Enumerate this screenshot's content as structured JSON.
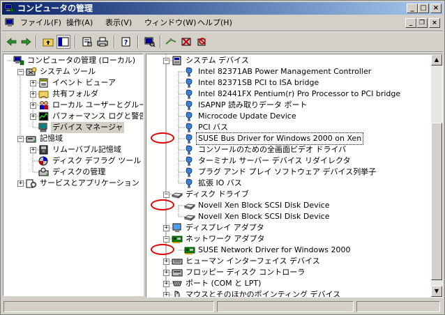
{
  "window": {
    "title": "コンピュータの管理"
  },
  "caption_buttons": {
    "minimize": "_",
    "maximize": "□",
    "close": "×"
  },
  "mdi_buttons": {
    "minimize": "_",
    "restore": "❐",
    "close": "×"
  },
  "menu": [
    {
      "label": "ファイル(F)"
    },
    {
      "label": "操作(A)"
    },
    {
      "label": "表示(V)"
    },
    {
      "label": "ウィンドウ(W)"
    },
    {
      "label": "ヘルプ(H)"
    }
  ],
  "left_tree": [
    {
      "label": "コンピュータの管理 (ローカル)",
      "icon": "computer-management-icon",
      "level": 0,
      "expander": ""
    },
    {
      "label": "システム ツール",
      "icon": "system-tools-icon",
      "level": 1,
      "expander": "-"
    },
    {
      "label": "イベント ビューア",
      "icon": "event-viewer-icon",
      "level": 2,
      "expander": "+"
    },
    {
      "label": "共有フォルダ",
      "icon": "shared-folders-icon",
      "level": 2,
      "expander": "+"
    },
    {
      "label": "ローカル ユーザーとグループ",
      "icon": "users-icon",
      "level": 2,
      "expander": "+"
    },
    {
      "label": "パフォーマンス ログと警告",
      "icon": "performance-icon",
      "level": 2,
      "expander": "+"
    },
    {
      "label": "デバイス マネージャ",
      "icon": "device-manager-icon",
      "level": 2,
      "expander": "",
      "selected": true
    },
    {
      "label": "記憶域",
      "icon": "storage-icon",
      "level": 1,
      "expander": "-"
    },
    {
      "label": "リムーバブル記憶域",
      "icon": "removable-storage-icon",
      "level": 2,
      "expander": "+"
    },
    {
      "label": "ディスク デフラグ ツール",
      "icon": "defrag-icon",
      "level": 2,
      "expander": ""
    },
    {
      "label": "ディスクの管理",
      "icon": "disk-management-icon",
      "level": 2,
      "expander": ""
    },
    {
      "label": "サービスとアプリケーション",
      "icon": "services-icon",
      "level": 1,
      "expander": "+"
    }
  ],
  "right_tree": [
    {
      "label": "システム デバイス",
      "icon": "system-device-icon",
      "level": 0,
      "expander": "-"
    },
    {
      "label": "Intel 82371AB Power Management Controller",
      "icon": "device-icon",
      "level": 1
    },
    {
      "label": "Intel 82371SB PCI to ISA bridge",
      "icon": "device-icon",
      "level": 1
    },
    {
      "label": "Intel 82441FX Pentium(r) Pro Processor to PCI bridge",
      "icon": "device-icon",
      "level": 1
    },
    {
      "label": "ISAPNP 読み取りデータ ポート",
      "icon": "device-icon",
      "level": 1
    },
    {
      "label": "Microcode Update Device",
      "icon": "device-icon",
      "level": 1
    },
    {
      "label": "PCI バス",
      "icon": "device-icon",
      "level": 1
    },
    {
      "label": "SUSE Bus Driver for Windows 2000 on Xen",
      "icon": "device-icon",
      "level": 1,
      "highlight": true,
      "marked": true
    },
    {
      "label": "コンソールのための全画面ビデオ ドライバ",
      "icon": "device-icon",
      "level": 1
    },
    {
      "label": "ターミナル サーバー デバイス リダイレクタ",
      "icon": "device-icon",
      "level": 1
    },
    {
      "label": "プラグ アンド プレイ ソフトウェア デバイス列挙子",
      "icon": "device-icon",
      "level": 1
    },
    {
      "label": "拡張 IO バス",
      "icon": "device-icon",
      "level": 1
    },
    {
      "label": "ディスク ドライブ",
      "icon": "disk-drive-icon",
      "level": 0,
      "expander": "-"
    },
    {
      "label": "Novell Xen Block SCSI Disk Device",
      "icon": "disk-drive-icon",
      "level": 1,
      "marked": true
    },
    {
      "label": "Novell Xen Block SCSI Disk Device",
      "icon": "disk-drive-icon",
      "level": 1
    },
    {
      "label": "ディスプレイ アダプタ",
      "icon": "display-adapter-icon",
      "level": 0,
      "expander": "+"
    },
    {
      "label": "ネットワーク アダプタ",
      "icon": "network-adapter-icon",
      "level": 0,
      "expander": "-"
    },
    {
      "label": "SUSE Network Driver for Windows 2000",
      "icon": "network-adapter-icon",
      "level": 1,
      "marked": true
    },
    {
      "label": "ヒューマン インターフェイス デバイス",
      "icon": "hid-icon",
      "level": 0,
      "expander": "+"
    },
    {
      "label": "フロッピー ディスク コントローラ",
      "icon": "floppy-controller-icon",
      "level": 0,
      "expander": "+"
    },
    {
      "label": "ポート (COM と LPT)",
      "icon": "port-icon",
      "level": 0,
      "expander": "+"
    },
    {
      "label": "マウスとそのほかのポインティング デバイス",
      "icon": "mouse-icon",
      "level": 0,
      "expander": "+"
    }
  ],
  "colors": {
    "annotation": "#e00000",
    "titlebar_start": "#0a246a",
    "titlebar_end": "#a6caf0"
  }
}
